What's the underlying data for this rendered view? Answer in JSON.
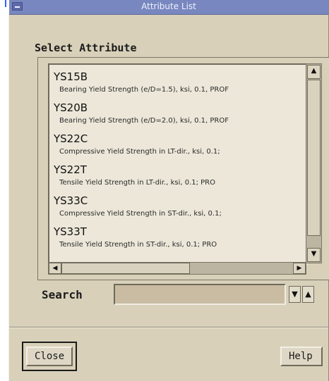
{
  "window": {
    "title": "Attribute List"
  },
  "section": {
    "label": "Select Attribute"
  },
  "list": {
    "items": [
      {
        "code": "YS15B",
        "desc": "Bearing Yield Strength (e/D=1.5), ksi, 0.1, PROF"
      },
      {
        "code": "YS20B",
        "desc": "Bearing Yield Strength (e/D=2.0), ksi, 0.1, PROF"
      },
      {
        "code": "YS22C",
        "desc": "Compressive Yield Strength in LT-dir., ksi, 0.1;"
      },
      {
        "code": "YS22T",
        "desc": "Tensile Yield Strength in LT-dir., ksi, 0.1; PRO"
      },
      {
        "code": "YS33C",
        "desc": "Compressive Yield Strength in ST-dir., ksi, 0.1;"
      },
      {
        "code": "YS33T",
        "desc": "Tensile Yield Strength in ST-dir., ksi, 0.1; PRO"
      }
    ]
  },
  "search": {
    "label": "Search",
    "value": "",
    "placeholder": ""
  },
  "buttons": {
    "close": "Close",
    "help": "Help"
  },
  "icons": {
    "scroll_up": "arrow-up-icon",
    "scroll_down": "arrow-down-icon",
    "scroll_left": "arrow-left-icon",
    "scroll_right": "arrow-right-icon",
    "search_down": "arrow-down-icon",
    "search_up": "arrow-up-icon"
  }
}
